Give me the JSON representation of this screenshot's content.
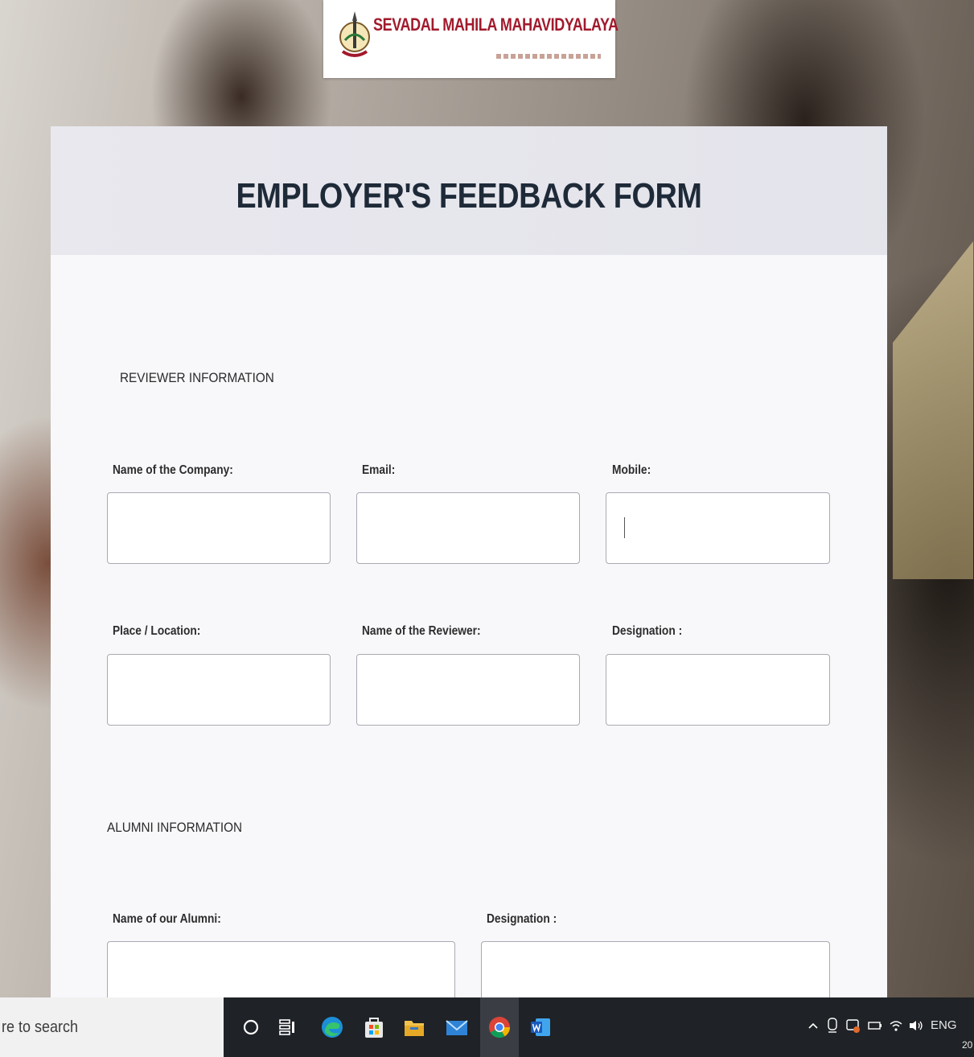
{
  "logo": {
    "name": "SEVADAL MAHILA MAHAVIDYALAYA",
    "brand_color": "#a11a2c"
  },
  "form": {
    "title": "EMPLOYER'S FEEDBACK FORM",
    "reviewer_section": {
      "heading": "REVIEWER INFORMATION",
      "fields": {
        "company": {
          "label": "Name of the Company:",
          "value": ""
        },
        "email": {
          "label": "Email:",
          "value": ""
        },
        "mobile": {
          "label": "Mobile:",
          "value": ""
        },
        "location": {
          "label": "Place / Location:",
          "value": ""
        },
        "reviewer_name": {
          "label": "Name of the Reviewer:",
          "value": ""
        },
        "designation": {
          "label": "Designation :",
          "value": ""
        }
      }
    },
    "alumni_section": {
      "heading": "ALUMNI INFORMATION",
      "fields": {
        "alumni_name": {
          "label": "Name of our Alumni:",
          "value": ""
        },
        "alumni_designation": {
          "label": "Designation :",
          "value": ""
        }
      }
    }
  },
  "taskbar": {
    "search_text": "re to search",
    "icons": [
      "cortana-icon",
      "task-view-icon",
      "edge-icon",
      "store-icon",
      "file-explorer-icon",
      "mail-icon",
      "chrome-icon",
      "word-icon"
    ],
    "tray": {
      "language": "ENG",
      "clock_fragment": "20"
    }
  }
}
